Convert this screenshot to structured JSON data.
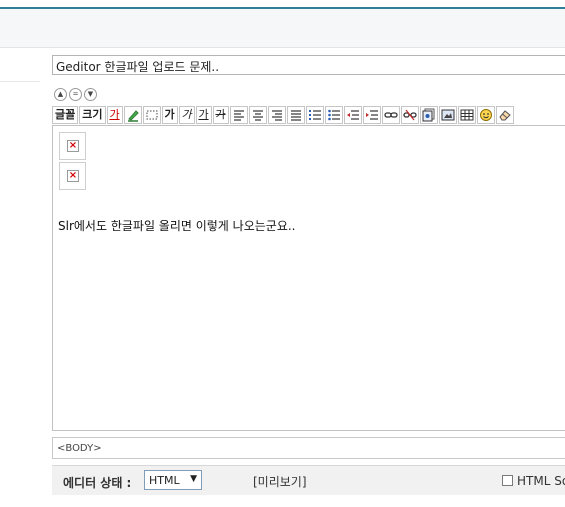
{
  "title_input": {
    "value": "Geditor 한글파일 업로드 문제.."
  },
  "toolbar": {
    "font_label": "글꼴",
    "size_label": "크기",
    "font_color_glyph": "가",
    "bold_glyph": "가",
    "italic_glyph": "가",
    "underline_glyph": "가",
    "strike_glyph": "가"
  },
  "editor": {
    "body_text": "Slr에서도 한글파일 올리면 이렇게 나오는군요.."
  },
  "tag_path": "<BODY>",
  "status_bar": {
    "mode_label": "에디터 상태 :",
    "mode_value": "HTML",
    "preview_label": "[미리보기]",
    "html_source_label": "HTML So"
  },
  "colors": {
    "accent_line": "#2f7f99",
    "broken_image_x": "#d40000"
  }
}
